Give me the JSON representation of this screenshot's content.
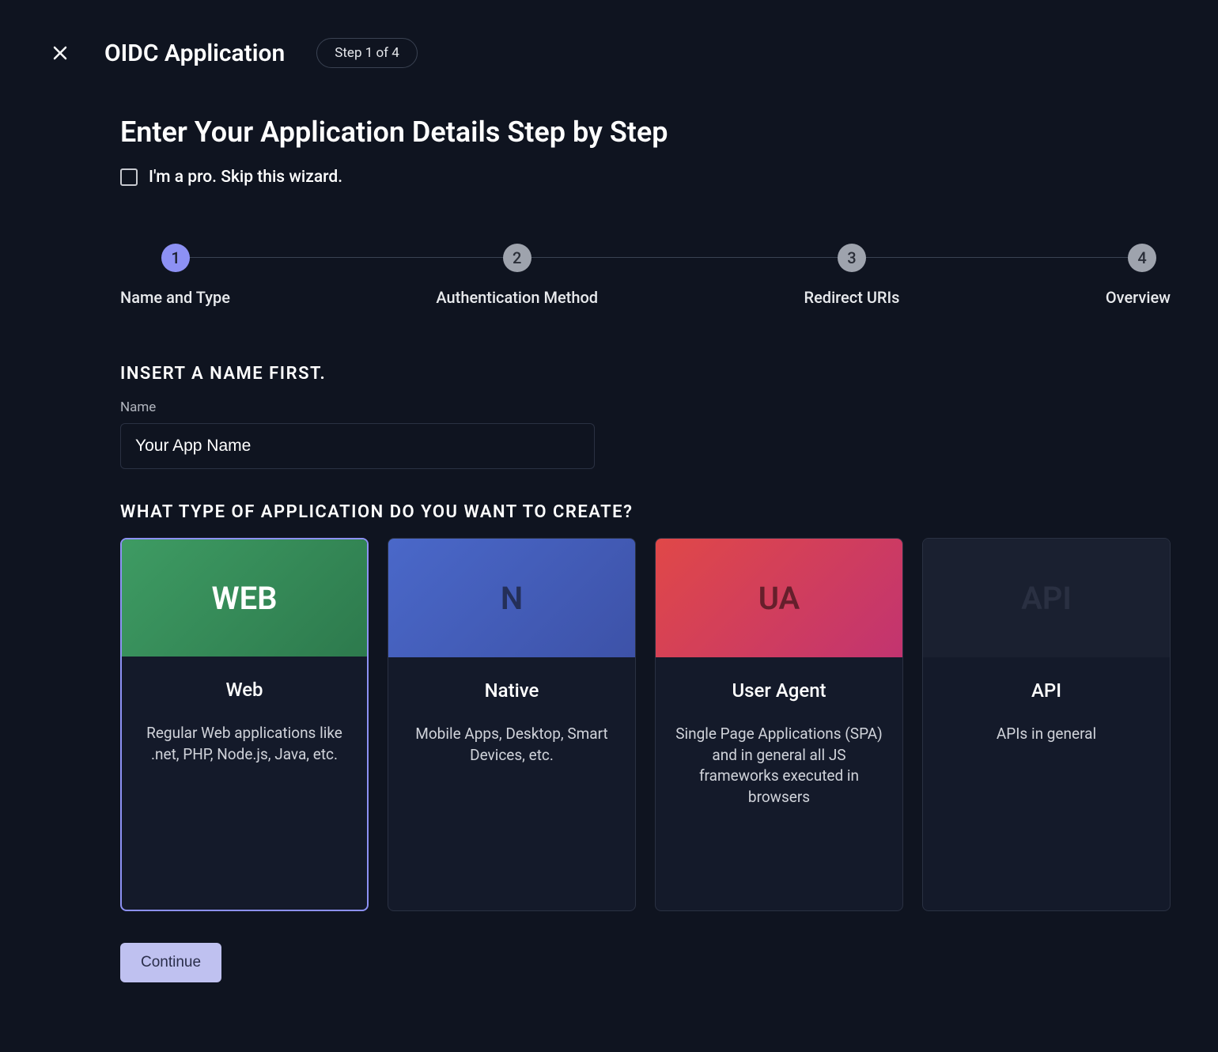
{
  "header": {
    "title": "OIDC Application",
    "step_badge": "Step 1 of 4"
  },
  "subtitle": "Enter Your Application Details Step by Step",
  "skip_wizard_label": "I'm a pro. Skip this wizard.",
  "stepper": [
    {
      "num": "1",
      "label": "Name and Type",
      "active": true
    },
    {
      "num": "2",
      "label": "Authentication Method",
      "active": false
    },
    {
      "num": "3",
      "label": "Redirect URIs",
      "active": false
    },
    {
      "num": "4",
      "label": "Overview",
      "active": false
    }
  ],
  "name_section": {
    "heading": "INSERT A NAME FIRST.",
    "field_label": "Name",
    "value": "Your App Name"
  },
  "type_section": {
    "heading": "WHAT TYPE OF APPLICATION DO YOU WANT TO CREATE?"
  },
  "cards": [
    {
      "hero": "WEB",
      "hero_class": "hero-web",
      "title": "Web",
      "desc": "Regular Web applications like .net, PHP, Node.js, Java, etc.",
      "selected": true
    },
    {
      "hero": "N",
      "hero_class": "hero-native",
      "title": "Native",
      "desc": "Mobile Apps, Desktop, Smart Devices, etc.",
      "selected": false
    },
    {
      "hero": "UA",
      "hero_class": "hero-ua",
      "title": "User Agent",
      "desc": "Single Page Applications (SPA) and in general all JS frameworks executed in browsers",
      "selected": false
    },
    {
      "hero": "API",
      "hero_class": "hero-api",
      "title": "API",
      "desc": "APIs in general",
      "selected": false
    }
  ],
  "continue_label": "Continue"
}
